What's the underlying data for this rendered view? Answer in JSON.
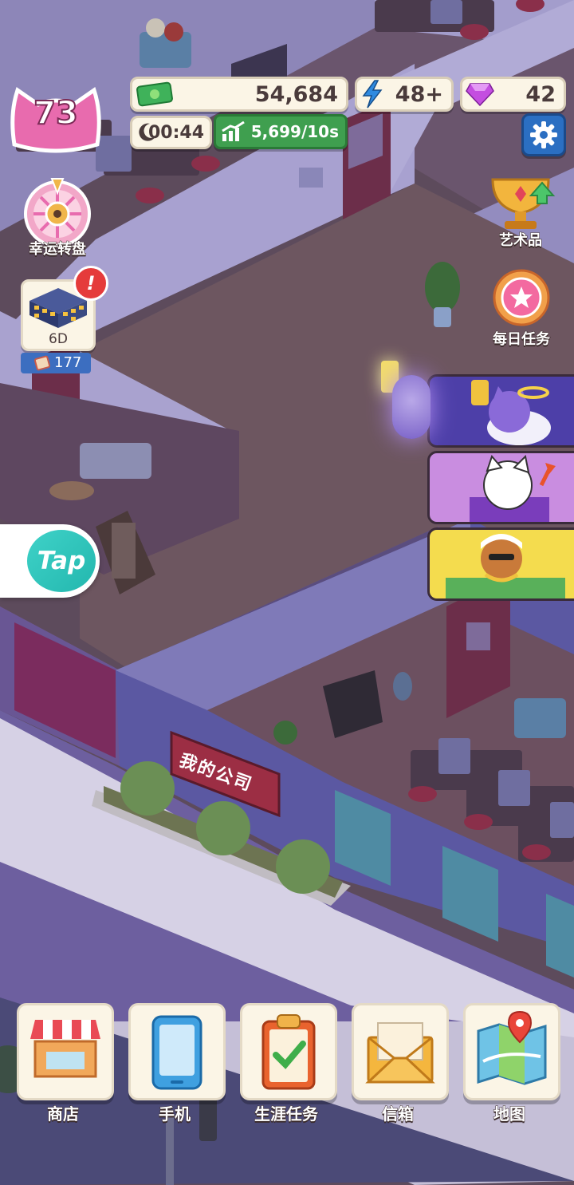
{
  "hud": {
    "level": "73",
    "money": "54,684",
    "energy": "48+",
    "gems": "42",
    "timer": "00:44",
    "income_rate": "5,699/10s"
  },
  "side_left": {
    "lucky_wheel_label": "幸运转盘",
    "building_label": "6D",
    "building_count": "177",
    "tap_label": "Tap"
  },
  "side_right": {
    "art_label": "艺术品",
    "daily_tasks_label": "每日任务"
  },
  "scene": {
    "company_sign": "我的公司"
  },
  "bottom_nav": [
    {
      "label": "商店",
      "icon": "shop-icon"
    },
    {
      "label": "手机",
      "icon": "phone-icon"
    },
    {
      "label": "生涯任务",
      "icon": "clipboard-check-icon"
    },
    {
      "label": "信箱",
      "icon": "mail-icon"
    },
    {
      "label": "地图",
      "icon": "map-icon"
    }
  ],
  "colors": {
    "money_green": "#3fb25a",
    "energy_blue": "#2e8ae0",
    "gem_purple": "#c44ee0",
    "income_green": "#3f9f4f",
    "level_pink": "#e86bae"
  }
}
